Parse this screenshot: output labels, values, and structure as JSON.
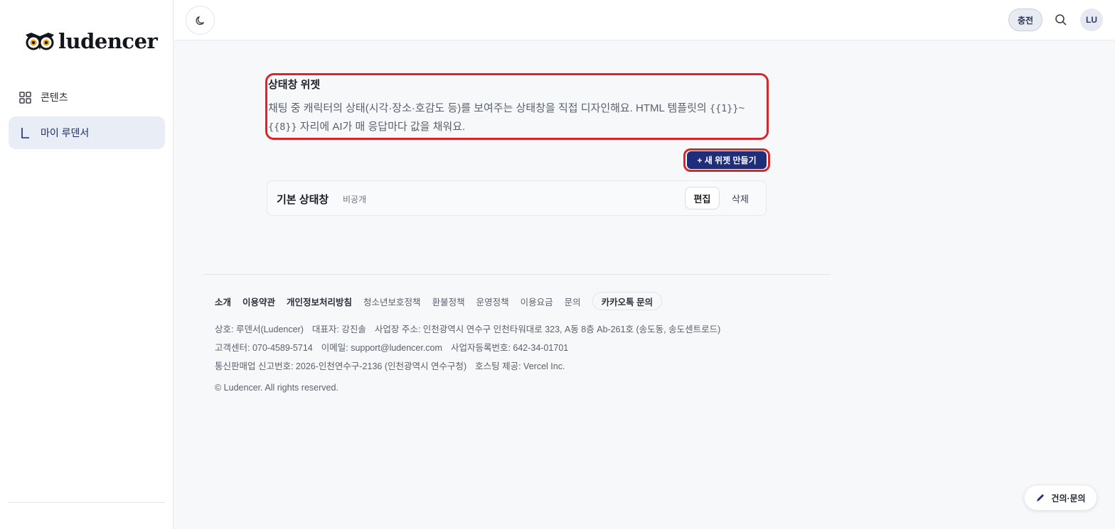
{
  "sidebar": {
    "logo_text": "ludencer",
    "items": [
      {
        "label": "콘텐츠",
        "icon": "grid-icon",
        "active": false
      },
      {
        "label": "마이 루덴서",
        "icon": "l-shape-icon",
        "active": true
      }
    ]
  },
  "topbar": {
    "theme_icon": "moon-icon",
    "charge_label": "충전",
    "search_icon": "search-icon",
    "avatar_initials": "LU"
  },
  "main": {
    "title": "상태창 위젯",
    "desc_part1": "채팅 중 캐릭터의 상태(시각·장소·호감도 등)를 보여주는 상태창을 직접 디자인해요. HTML 템플릿의 ",
    "desc_code1": "{{1}}",
    "desc_tilde": "~",
    "desc_code2": "{{8}}",
    "desc_part2": " 자리에 AI가 매 응답마다 값을 채워요.",
    "new_widget_label": "+ 새 위젯 만들기",
    "widgets": [
      {
        "name": "기본 상태창",
        "status": "비공개",
        "edit_label": "편집",
        "delete_label": "삭제"
      }
    ]
  },
  "footer": {
    "links": [
      {
        "label": "소개",
        "bold": true
      },
      {
        "label": "이용약관",
        "bold": true
      },
      {
        "label": "개인정보처리방침",
        "bold": true
      },
      {
        "label": "청소년보호정책",
        "bold": false
      },
      {
        "label": "환불정책",
        "bold": false
      },
      {
        "label": "운영정책",
        "bold": false
      },
      {
        "label": "이용요금",
        "bold": false
      },
      {
        "label": "문의",
        "bold": false
      }
    ],
    "kakao_label": "카카오톡 문의",
    "info1": [
      "상호: 루덴서(Ludencer)",
      "대표자: 강진솔",
      "사업장 주소: 인천광역시 연수구 인천타워대로 323, A동 8층 Ab-261호 (송도동, 송도센트로드)"
    ],
    "info2": [
      "고객센터: 070-4589-5714",
      "이메일: support@ludencer.com",
      "사업자등록번호: 642-34-01701"
    ],
    "info3": [
      "통신판매업 신고번호: 2026-인천연수구-2136 (인천광역시 연수구청)",
      "호스팅 제공: Vercel Inc."
    ],
    "copyright": "© Ludencer. All rights reserved."
  },
  "feedback": {
    "label": "건의·문의",
    "icon": "pencil-icon"
  },
  "colors": {
    "primary": "#1f2d7a",
    "highlight_ring": "#d9262b",
    "active_nav_bg": "#e9edf5"
  }
}
